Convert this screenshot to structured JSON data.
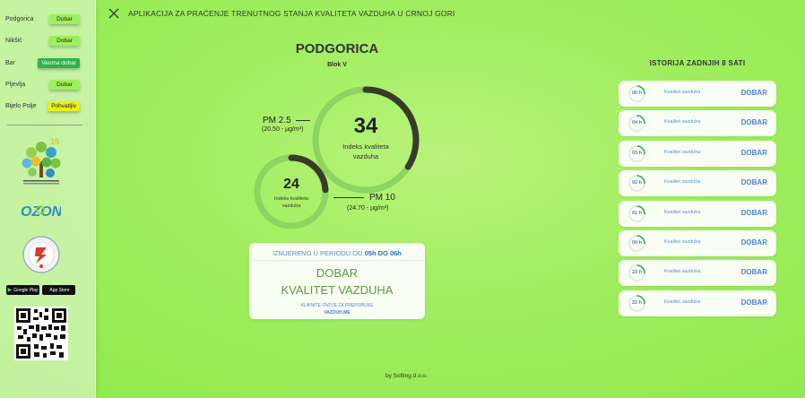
{
  "app": {
    "title": "APLIKACIJA ZA PRAĆENJE TRENUTNOG STANJA KVALITETA VAZDUHA U CRNOJ GORI"
  },
  "sidebar": {
    "cities": [
      {
        "name": "Podgorica",
        "status": "Dobar",
        "color": "#9ef05b"
      },
      {
        "name": "Nikšić",
        "status": "Dobar",
        "color": "#9ef05b"
      },
      {
        "name": "Bar",
        "status": "Veoma dobar",
        "color": "#2db34a"
      },
      {
        "name": "Pljevlja",
        "status": "Dobar",
        "color": "#9ef05b"
      },
      {
        "name": "Bijelo Polje",
        "status": "Prihvatljiv",
        "color": "#e8ef1d"
      }
    ],
    "ozon_logo": "OZON",
    "store_buttons": {
      "google": "Google Play",
      "apple": "App Store"
    }
  },
  "main": {
    "city": "PODGORICA",
    "station": "Blok V",
    "gauge_large": {
      "value": "34",
      "label_line1": "Indeks kvaliteta",
      "label_line2": "vazduha",
      "fill": 0.34
    },
    "gauge_small": {
      "value": "24",
      "label_line1": "Indeks kvaliteta",
      "label_line2": "vazduha",
      "fill": 0.24
    },
    "pm25": {
      "label": "PM 2.5",
      "value": "(20.50 - µg/m³)"
    },
    "pm10": {
      "label": "PM 10",
      "value": "(24.70 - µg/m³)"
    },
    "card": {
      "period_prefix": "IZMJERENO U PERIODU OD",
      "period_range": "05h DO 06h",
      "status_line1": "DOBAR",
      "status_line2": "KVALITET VAZDUHA",
      "link_line1": "KLIKNITE OVDJE ZA PREPORUKE",
      "link_line2": "VAZDUH.ME"
    },
    "footer": "by Softing d.o.o."
  },
  "history": {
    "title": "ISTORIJA ZADNJIH 8 SATI",
    "items": [
      {
        "hour": "05 h",
        "label": "Kvalitet vazduha",
        "status": "DOBAR"
      },
      {
        "hour": "04 h",
        "label": "Kvalitet vazduha",
        "status": "DOBAR"
      },
      {
        "hour": "03 h",
        "label": "Kvalitet vazduha",
        "status": "DOBAR"
      },
      {
        "hour": "02 h",
        "label": "Kvalitet vazduha",
        "status": "DOBAR"
      },
      {
        "hour": "01 h",
        "label": "Kvalitet vazduha",
        "status": "DOBAR"
      },
      {
        "hour": "00 h",
        "label": "Kvalitet vazduha",
        "status": "DOBAR"
      },
      {
        "hour": "23 h",
        "label": "Kvalitet vazduha",
        "status": "DOBAR"
      },
      {
        "hour": "22 h",
        "label": "Kvalitet vazduha",
        "status": "DOBAR"
      }
    ]
  },
  "colors": {
    "accent_blue": "#4e82d8",
    "gauge_track": "#8dd460",
    "gauge_fill": "#3a3a2a",
    "good": "#9ef05b",
    "very_good": "#2db34a",
    "acceptable": "#e8ef1d"
  }
}
